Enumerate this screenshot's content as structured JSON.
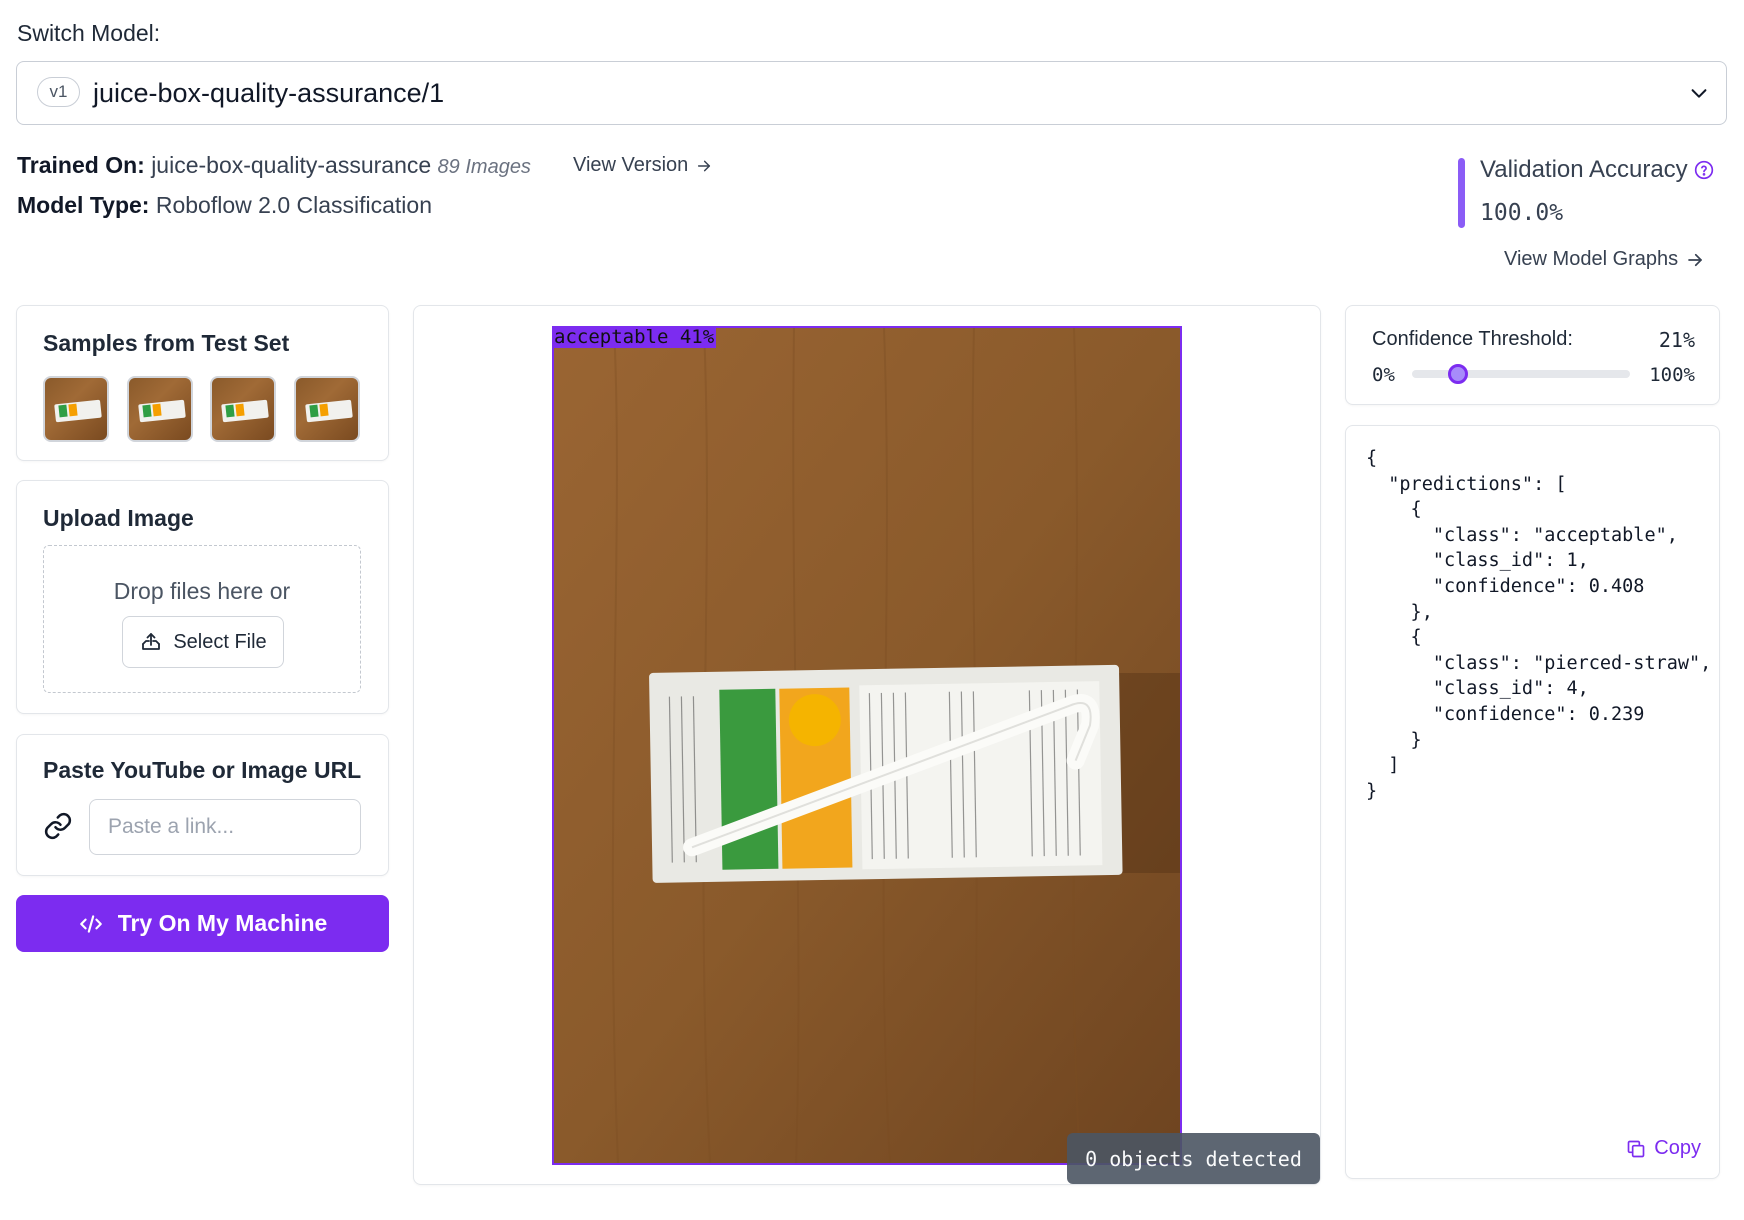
{
  "header": {
    "switch_label": "Switch Model:",
    "version": "v1",
    "model_name": "juice-box-quality-assurance/1"
  },
  "model_info": {
    "trained_on_label": "Trained On:",
    "trained_on_value": "juice-box-quality-assurance",
    "images_count": "89 Images",
    "view_version": "View Version",
    "model_type_label": "Model Type:",
    "model_type_value": "Roboflow 2.0 Classification"
  },
  "validation": {
    "title": "Validation Accuracy",
    "value": "100.0%",
    "view_graphs": "View Model Graphs"
  },
  "samples": {
    "title": "Samples from Test Set",
    "count": 4
  },
  "upload": {
    "title": "Upload Image",
    "drop_text": "Drop files here or",
    "select_file": "Select File"
  },
  "url": {
    "title": "Paste YouTube or Image URL",
    "placeholder": "Paste a link..."
  },
  "try_button": "Try On My Machine",
  "preview": {
    "prediction_label": "acceptable 41%",
    "objects_detected": "0 objects detected"
  },
  "confidence": {
    "label": "Confidence Threshold:",
    "value_text": "21%",
    "value": 0.21,
    "min_label": "0%",
    "max_label": "100%"
  },
  "json_output": "{\n  \"predictions\": [\n    {\n      \"class\": \"acceptable\",\n      \"class_id\": 1,\n      \"confidence\": 0.408\n    },\n    {\n      \"class\": \"pierced-straw\",\n      \"class_id\": 4,\n      \"confidence\": 0.239\n    }\n  ]\n}",
  "copy_label": "Copy",
  "colors": {
    "accent": "#7c2cf0",
    "accent_light": "#8b5cf6"
  }
}
